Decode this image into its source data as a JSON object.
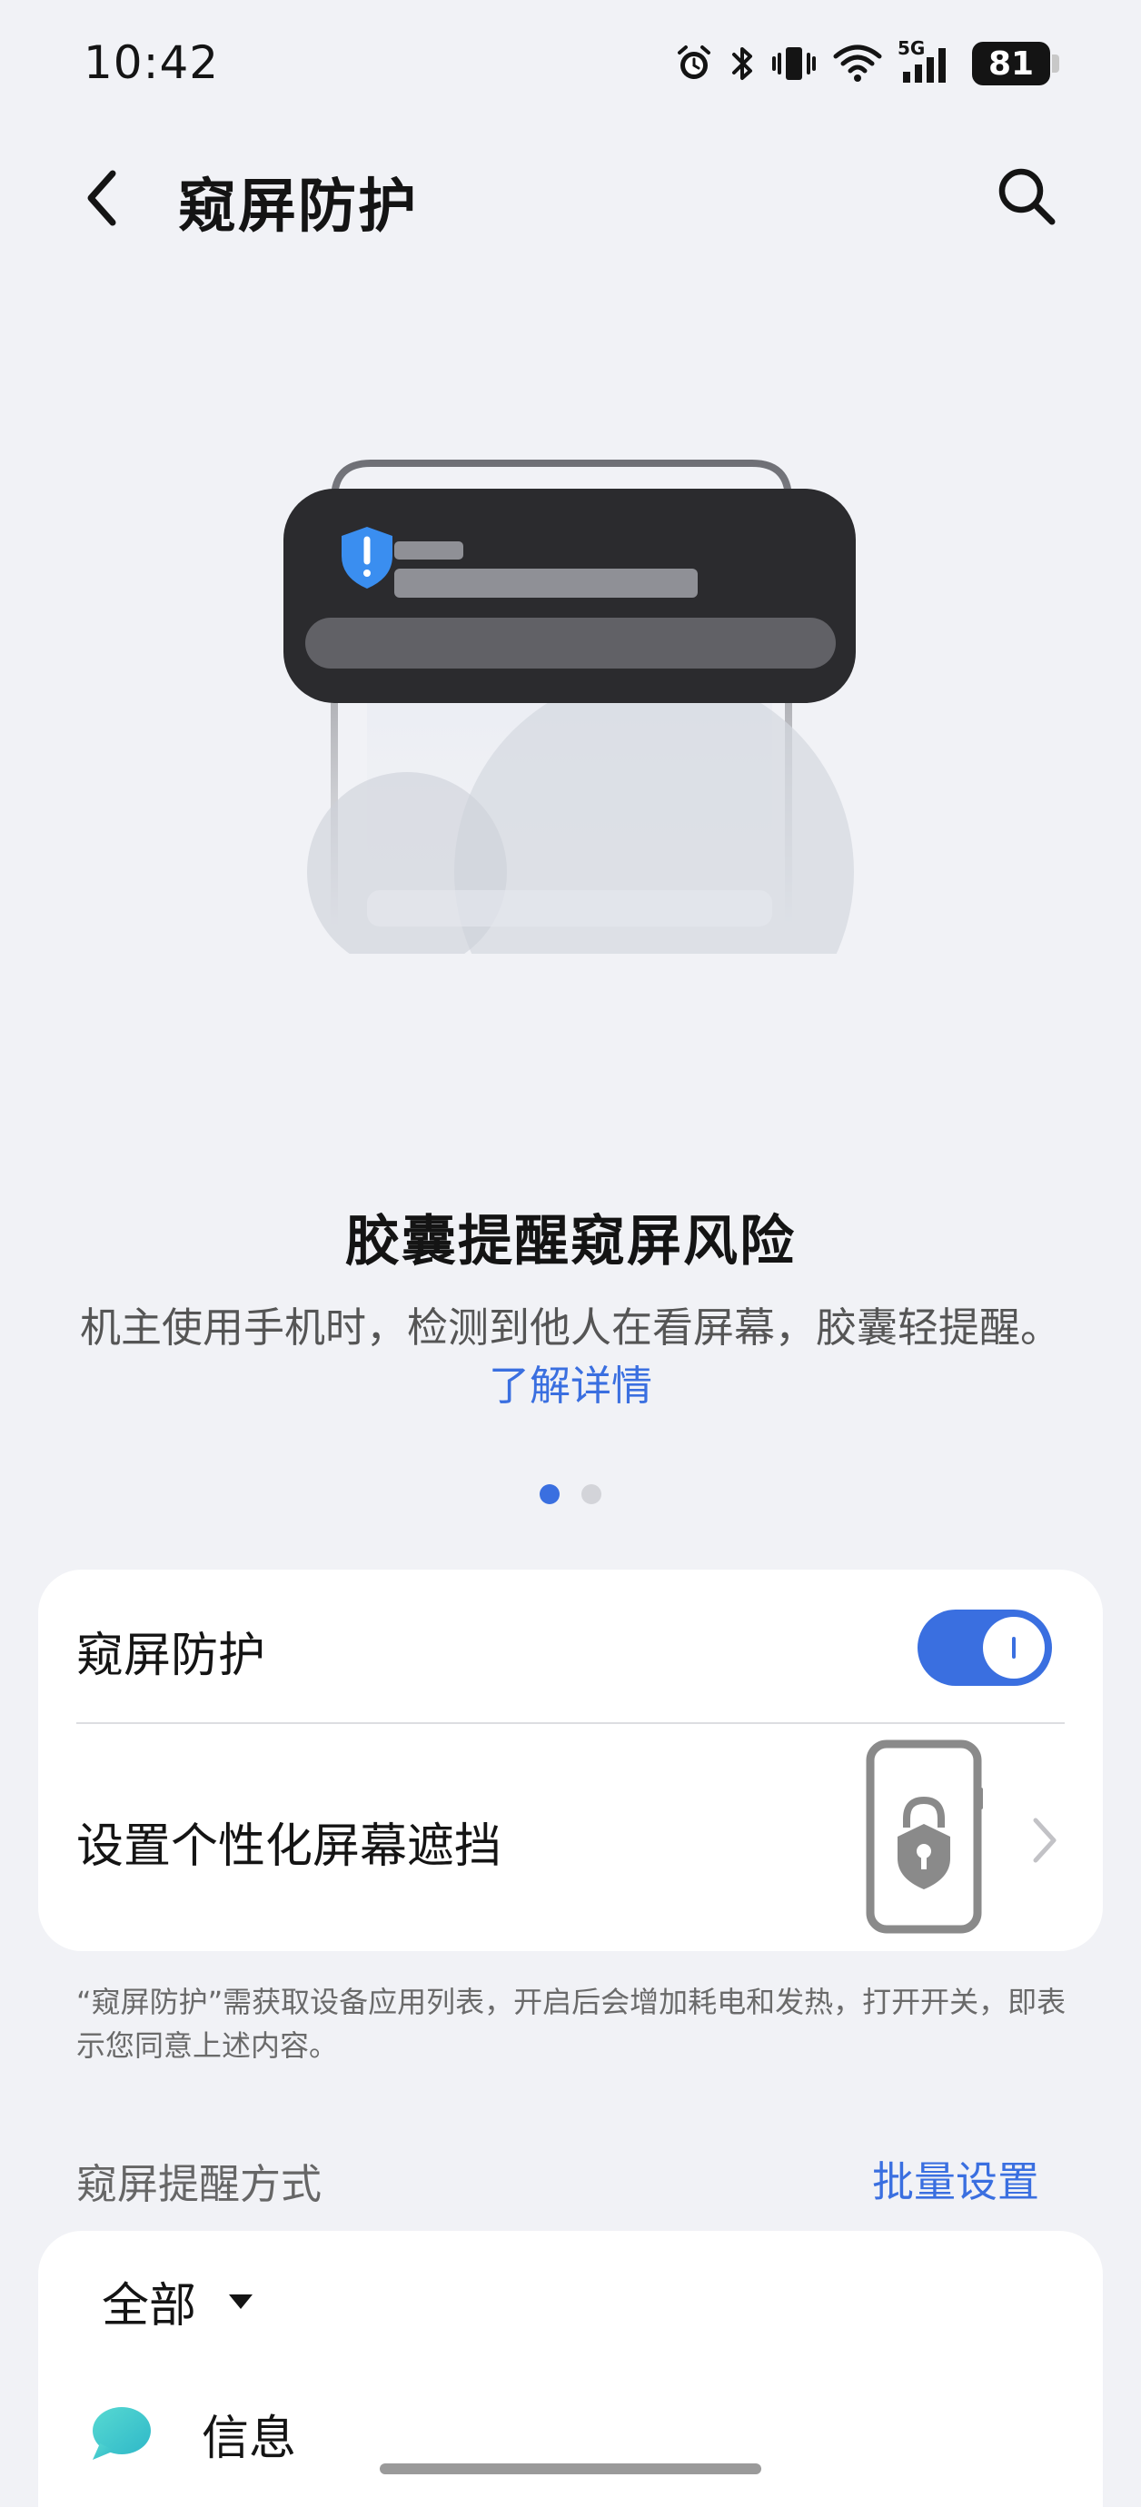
{
  "status_bar": {
    "time": "10:42",
    "network": "5G",
    "battery": "81"
  },
  "header": {
    "title": "窥屏防护",
    "back_icon": "back-arrow-icon",
    "search_icon": "search-icon"
  },
  "carousel": {
    "title": "胶囊提醒窥屏风险",
    "description": "机主使用手机时，检测到他人在看屏幕，胶囊轻提醒。",
    "link": "了解详情",
    "page_count": 2,
    "active_page": 1
  },
  "settings_card": {
    "protection_label": "窥屏防护",
    "protection_enabled": true,
    "custom_mask_label": "设置个性化屏幕遮挡"
  },
  "note": "“窥屏防护”需获取设备应用列表，开启后会增加耗电和发热，打开开关，即表示您同意上述内容。",
  "reminder_section": {
    "label": "窥屏提醒方式",
    "batch_label": "批量设置"
  },
  "app_list": {
    "filter_label": "全部",
    "apps": [
      {
        "label": "信息",
        "icon": "message-bubble-icon"
      }
    ]
  },
  "colors": {
    "accent": "#3a6fe0",
    "background": "#f1f2f6",
    "card": "#ffffff"
  }
}
